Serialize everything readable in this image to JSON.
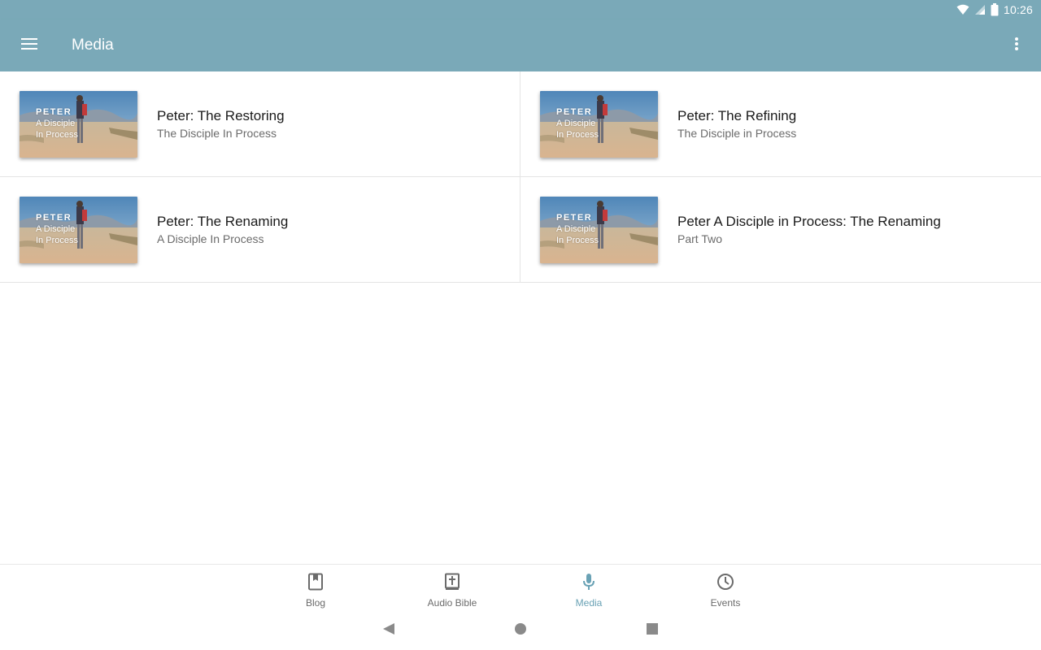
{
  "status_bar": {
    "time": "10:26",
    "icons": [
      "wifi-icon",
      "signal-icon",
      "battery-icon"
    ]
  },
  "app_bar": {
    "title": "Media",
    "menu_icon": "menu-icon",
    "overflow_icon": "more-vert-icon"
  },
  "media_items": [
    {
      "title": "Peter: The Restoring",
      "subtitle": "The Disciple In Process",
      "thumbnail": {
        "line1": "PETER",
        "line2": "A Disciple",
        "line3": "In Process"
      }
    },
    {
      "title": "Peter: The Refining",
      "subtitle": "The Disciple in Process",
      "thumbnail": {
        "line1": "PETER",
        "line2": "A Disciple",
        "line3": "In Process"
      }
    },
    {
      "title": "Peter: The Renaming",
      "subtitle": "A Disciple In Process",
      "thumbnail": {
        "line1": "PETER",
        "line2": "A Disciple",
        "line3": "In Process"
      }
    },
    {
      "title": "Peter  A Disciple in Process: The Renaming",
      "subtitle": "Part Two",
      "thumbnail": {
        "line1": "PETER",
        "line2": "A Disciple",
        "line3": "In Process"
      }
    }
  ],
  "bottom_nav": {
    "tabs": [
      {
        "label": "Blog",
        "icon": "book-icon",
        "active": false
      },
      {
        "label": "Audio Bible",
        "icon": "bible-icon",
        "active": false
      },
      {
        "label": "Media",
        "icon": "microphone-icon",
        "active": true
      },
      {
        "label": "Events",
        "icon": "clock-icon",
        "active": false
      }
    ],
    "active_color": "#6aa2b5"
  },
  "theme": {
    "primary": "#7aa9b8"
  },
  "system_nav": {
    "buttons": [
      "back-icon",
      "home-icon",
      "recents-icon"
    ]
  }
}
